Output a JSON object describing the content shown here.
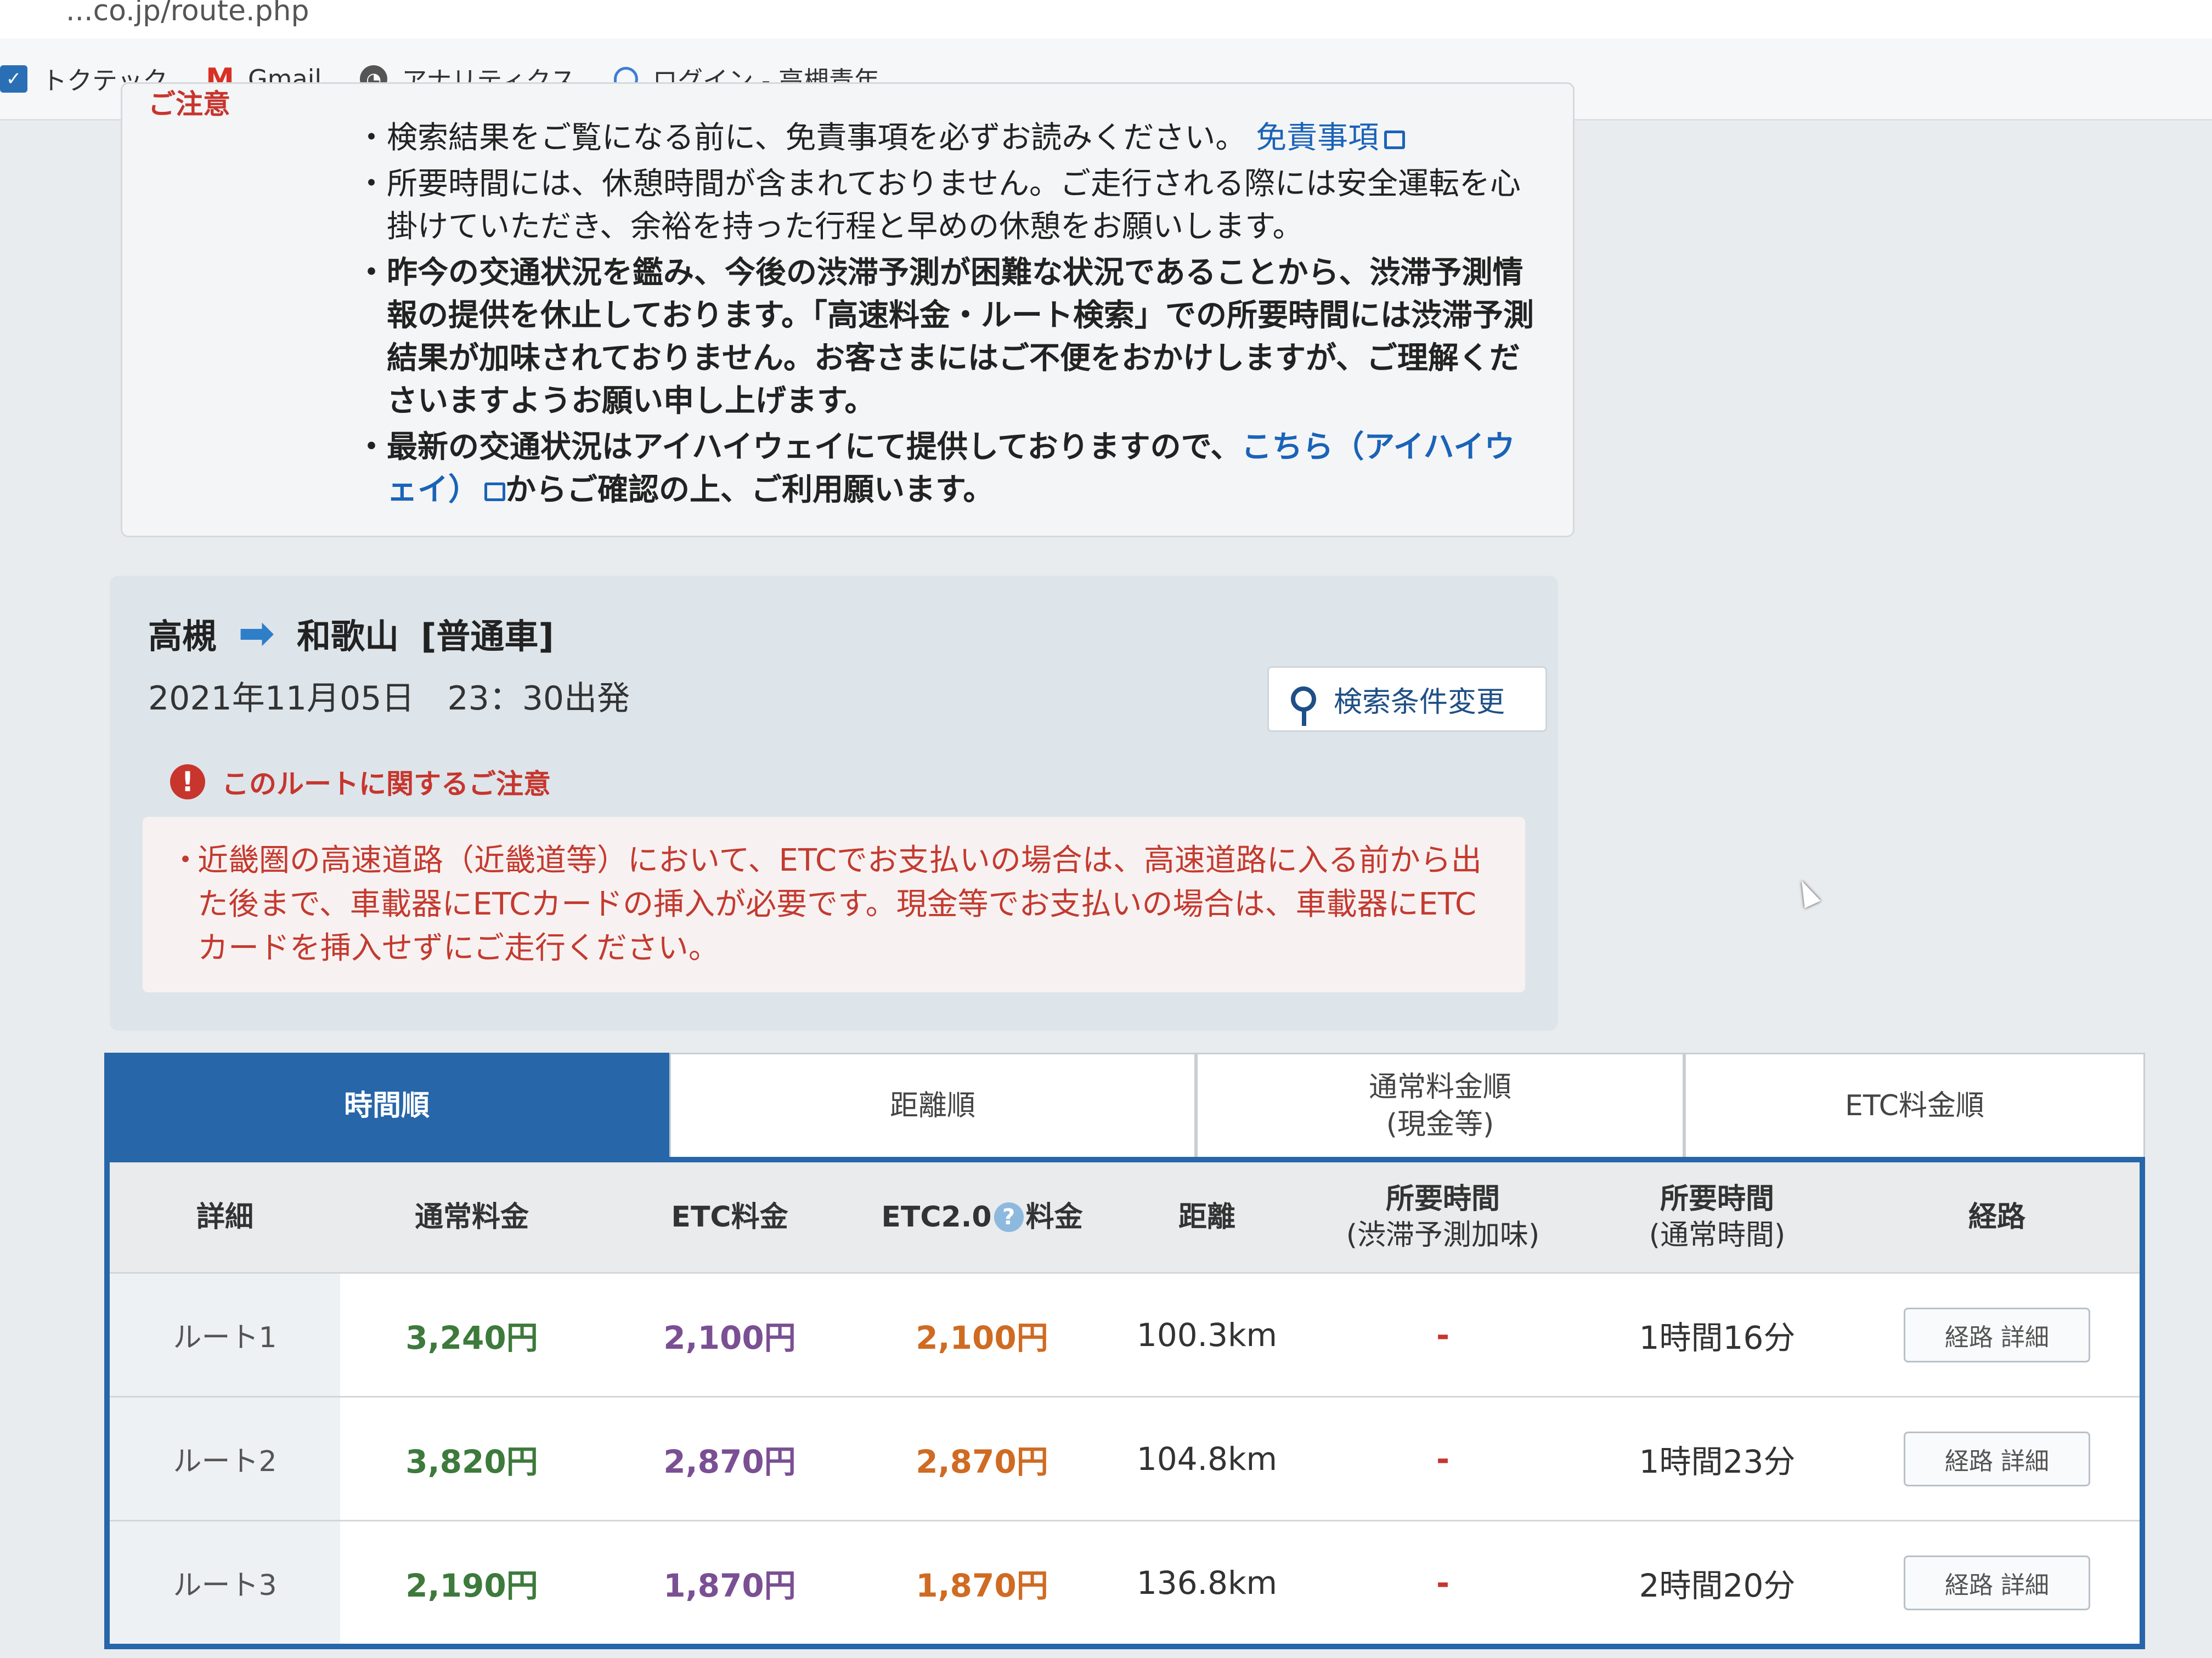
{
  "browser": {
    "url_text": "...co.jp/route.php",
    "bookmarks": [
      {
        "label": "トクテック",
        "icon": "toktech-icon"
      },
      {
        "label": "Gmail",
        "icon": "gmail-icon"
      },
      {
        "label": "アナリティクス",
        "icon": "analytics-icon"
      },
      {
        "label": "ログイン - 高槻青年...",
        "icon": "login-icon"
      }
    ]
  },
  "notice": {
    "title": "ご注意",
    "items": [
      {
        "text": "検索結果をご覧になる前に、免責事項を必ずお読みください。",
        "link": "免責事項"
      },
      {
        "text": "所要時間には、休憩時間が含まれておりません。ご走行される際には安全運転を心掛けていただき、余裕を持った行程と早めの休憩をお願いします。"
      },
      {
        "text": "昨今の交通状況を鑑み、今後の渋滞予測が困難な状況であることから、渋滞予測情報の提供を休止しております。「高速料金・ルート検索」での所要時間には渋滞予測結果が加味されておりません。お客さまにはご不便をおかけしますが、ご理解くださいますようお願い申し上げます。"
      },
      {
        "text": "最新の交通状況はアイハイウェイにて提供しておりますので、",
        "link": "こちら（アイハイウェイ）",
        "text_after": "からご確認の上、ご利用願います。"
      }
    ]
  },
  "route": {
    "from": "高槻",
    "to": "和歌山",
    "vehicle": "[普通車]",
    "datetime": "2021年11月05日　23：30出発",
    "change_button": "検索条件変更",
    "caution_title": "このルートに関するご注意",
    "caution_text": "近畿圏の高速道路（近畿道等）において、ETCでお支払いの場合は、高速道路に入る前から出た後まで、車載器にETCカードの挿入が必要です。現金等でお支払いの場合は、車載器にETCカードを挿入せずにご走行ください。"
  },
  "tabs": [
    {
      "label": "時間順",
      "active": true
    },
    {
      "label": "距離順",
      "active": false
    },
    {
      "label": "通常料金順\n(現金等)",
      "active": false
    },
    {
      "label": "ETC料金順",
      "active": false
    }
  ],
  "table": {
    "headers": {
      "detail": "詳細",
      "normal": "通常料金",
      "etc": "ETC料金",
      "etc2_a": "ETC2.0",
      "etc2_b": "料金",
      "distance": "距離",
      "time_jam": "所要時間",
      "time_jam_sub": "(渋滞予測加味)",
      "time_normal": "所要時間",
      "time_normal_sub": "(通常時間)",
      "route": "経路"
    },
    "rows": [
      {
        "name": "ルート1",
        "normal": "3,240円",
        "etc": "2,100円",
        "etc2": "2,100円",
        "distance": "100.3km",
        "time_jam": "-",
        "time_normal": "1時間16分",
        "button": "経路 詳細"
      },
      {
        "name": "ルート2",
        "normal": "3,820円",
        "etc": "2,870円",
        "etc2": "2,870円",
        "distance": "104.8km",
        "time_jam": "-",
        "time_normal": "1時間23分",
        "button": "経路 詳細"
      },
      {
        "name": "ルート3",
        "normal": "2,190円",
        "etc": "1,870円",
        "etc2": "1,870円",
        "distance": "136.8km",
        "time_jam": "-",
        "time_normal": "2時間20分",
        "button": "経路 詳細"
      }
    ]
  },
  "colors": {
    "accent_blue": "#2666a9",
    "caution_red": "#c7352d",
    "normal_fee_green": "#3d7a3c",
    "etc_purple": "#7a4f93",
    "etc2_orange": "#cf6b22"
  }
}
